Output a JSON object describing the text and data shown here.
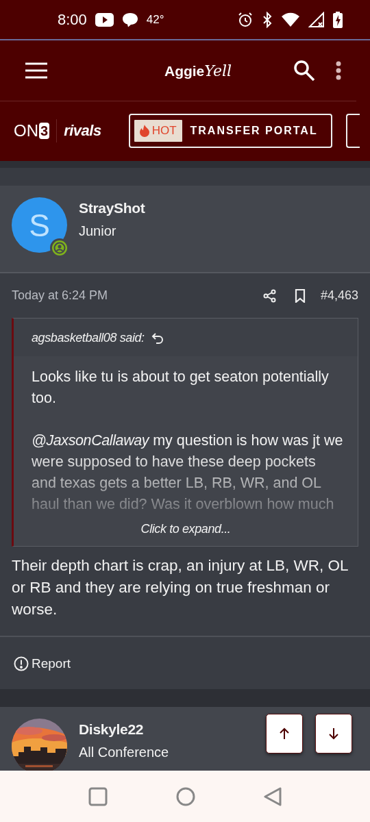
{
  "status_bar": {
    "time": "8:00",
    "temperature": "42°"
  },
  "header": {
    "logo": {
      "bold": "Aggie",
      "script": "Yell"
    }
  },
  "partners": {
    "on3": {
      "letters": "ON",
      "boxed": "3"
    },
    "rivals": "rivals"
  },
  "hot_link": {
    "badge": "HOT",
    "label": "TRANSFER PORTAL"
  },
  "post": {
    "author": {
      "name": "StrayShot",
      "initial": "S",
      "title": "Junior",
      "online": true
    },
    "time": "Today at 6:24 PM",
    "number": "#4,463",
    "quote": {
      "author": "agsbasketball08 said:",
      "paragraphs": [
        {
          "text": "Looks like tu is about to get seaton potentially too."
        },
        {
          "mention": "@JaxsonCallaway",
          "text": "my question is how was jt we were supposed to have these deep pockets and texas gets a better LB, RB, WR, and OL haul than we did? Was it overblown how much"
        }
      ],
      "expand": "Click to expand..."
    },
    "body": "Their depth chart is crap, an injury at LB, WR, OL or RB and they are relying on true freshman or worse.",
    "report": "Report"
  },
  "next_post": {
    "author": {
      "name": "Diskyle22",
      "title": "All Conference"
    }
  }
}
